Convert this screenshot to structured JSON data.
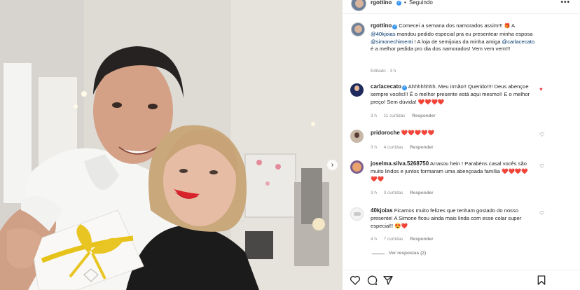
{
  "post": {
    "author": "rgottino",
    "follow_label": "Seguindo",
    "more_label": "•••",
    "caption_user": "rgottino",
    "caption_parts": [
      "Comecei a semana dos namorados assim!!! ",
      " A ",
      "@40kjoias",
      " mandou pedido especial pra eu presentear minha esposa ",
      "@simonechimenti",
      " ! A loja de semijoias da minha amiga ",
      "@carlacecato",
      " é a melhor pedida pro dia dos namorados! Vem vem vem!!!"
    ],
    "caption_time": "Editado · 3 h"
  },
  "comments": [
    {
      "user": "carlacecato",
      "text": "Ahhhhhhhh. Meu irmão!! Querido!!!! Deus abençoe sempre vocês!!! É o melhor presente está aqui mesmo!! E o melhor preço! Sem dúvida! ❤️❤️❤️❤️",
      "time": "3 h",
      "likes": "11 curtidas",
      "reply": "Responder",
      "liked": true
    },
    {
      "user": "pridoroche",
      "text": "❤️❤️❤️❤️❤️",
      "time": "3 h",
      "likes": "4 curtidas",
      "reply": "Responder",
      "liked": false
    },
    {
      "user": "joselma.silva.5268750",
      "text": "Arrasou hein ! Parabéns casal vocês são muito lindos e juntos formaram uma abençoada família ❤️❤️❤️❤️❤️❤️",
      "time": "3 h",
      "likes": "3 curtidas",
      "reply": "Responder",
      "liked": false
    },
    {
      "user": "40kjoias",
      "text": "Ficamos muito felizes que tenham gostado do nosso presente! A Simone ficou ainda mais linda com esse colar super especial!! 😍❤️",
      "time": "4 h",
      "likes": "7 curtidas",
      "reply": "Responder",
      "liked": false
    }
  ],
  "view_replies": "Ver respostas (2)",
  "icons": {
    "verified": "✓",
    "heart": "♥",
    "heart_outline": "♡",
    "next": "›",
    "gift": "🎁"
  },
  "colors": {
    "verified": "#3897f0",
    "liked": "#ed4956",
    "mention": "#00376b",
    "meta": "#8e8e8e"
  }
}
